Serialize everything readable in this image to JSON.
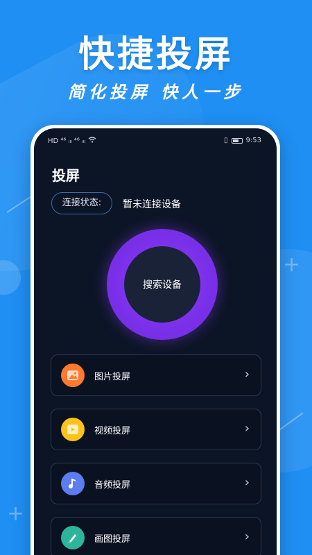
{
  "hero": {
    "headline": "快捷投屏",
    "subline": "简化投屏 快人一步"
  },
  "status_bar": {
    "left_text": "HD  ⁴⁶ ᵢₗₗ ⁴⁶ ᵢₗₗ",
    "time": "9:53"
  },
  "app": {
    "title": "投屏",
    "connection": {
      "label": "连接状态:",
      "value": "暂未连接设备"
    },
    "search_button": "搜索设备",
    "menu": [
      {
        "label": "图片投屏",
        "icon": "image-icon",
        "color": "#ff7a2f"
      },
      {
        "label": "视频投屏",
        "icon": "video-icon",
        "color": "#ffc21a"
      },
      {
        "label": "音频投屏",
        "icon": "music-icon",
        "color": "#5c7cf0"
      },
      {
        "label": "画图投屏",
        "icon": "brush-icon",
        "color": "#2db59b"
      }
    ]
  },
  "colors": {
    "background": "#1f8ff3",
    "screen": "#0c1526",
    "ring": "#8d3ff5"
  }
}
